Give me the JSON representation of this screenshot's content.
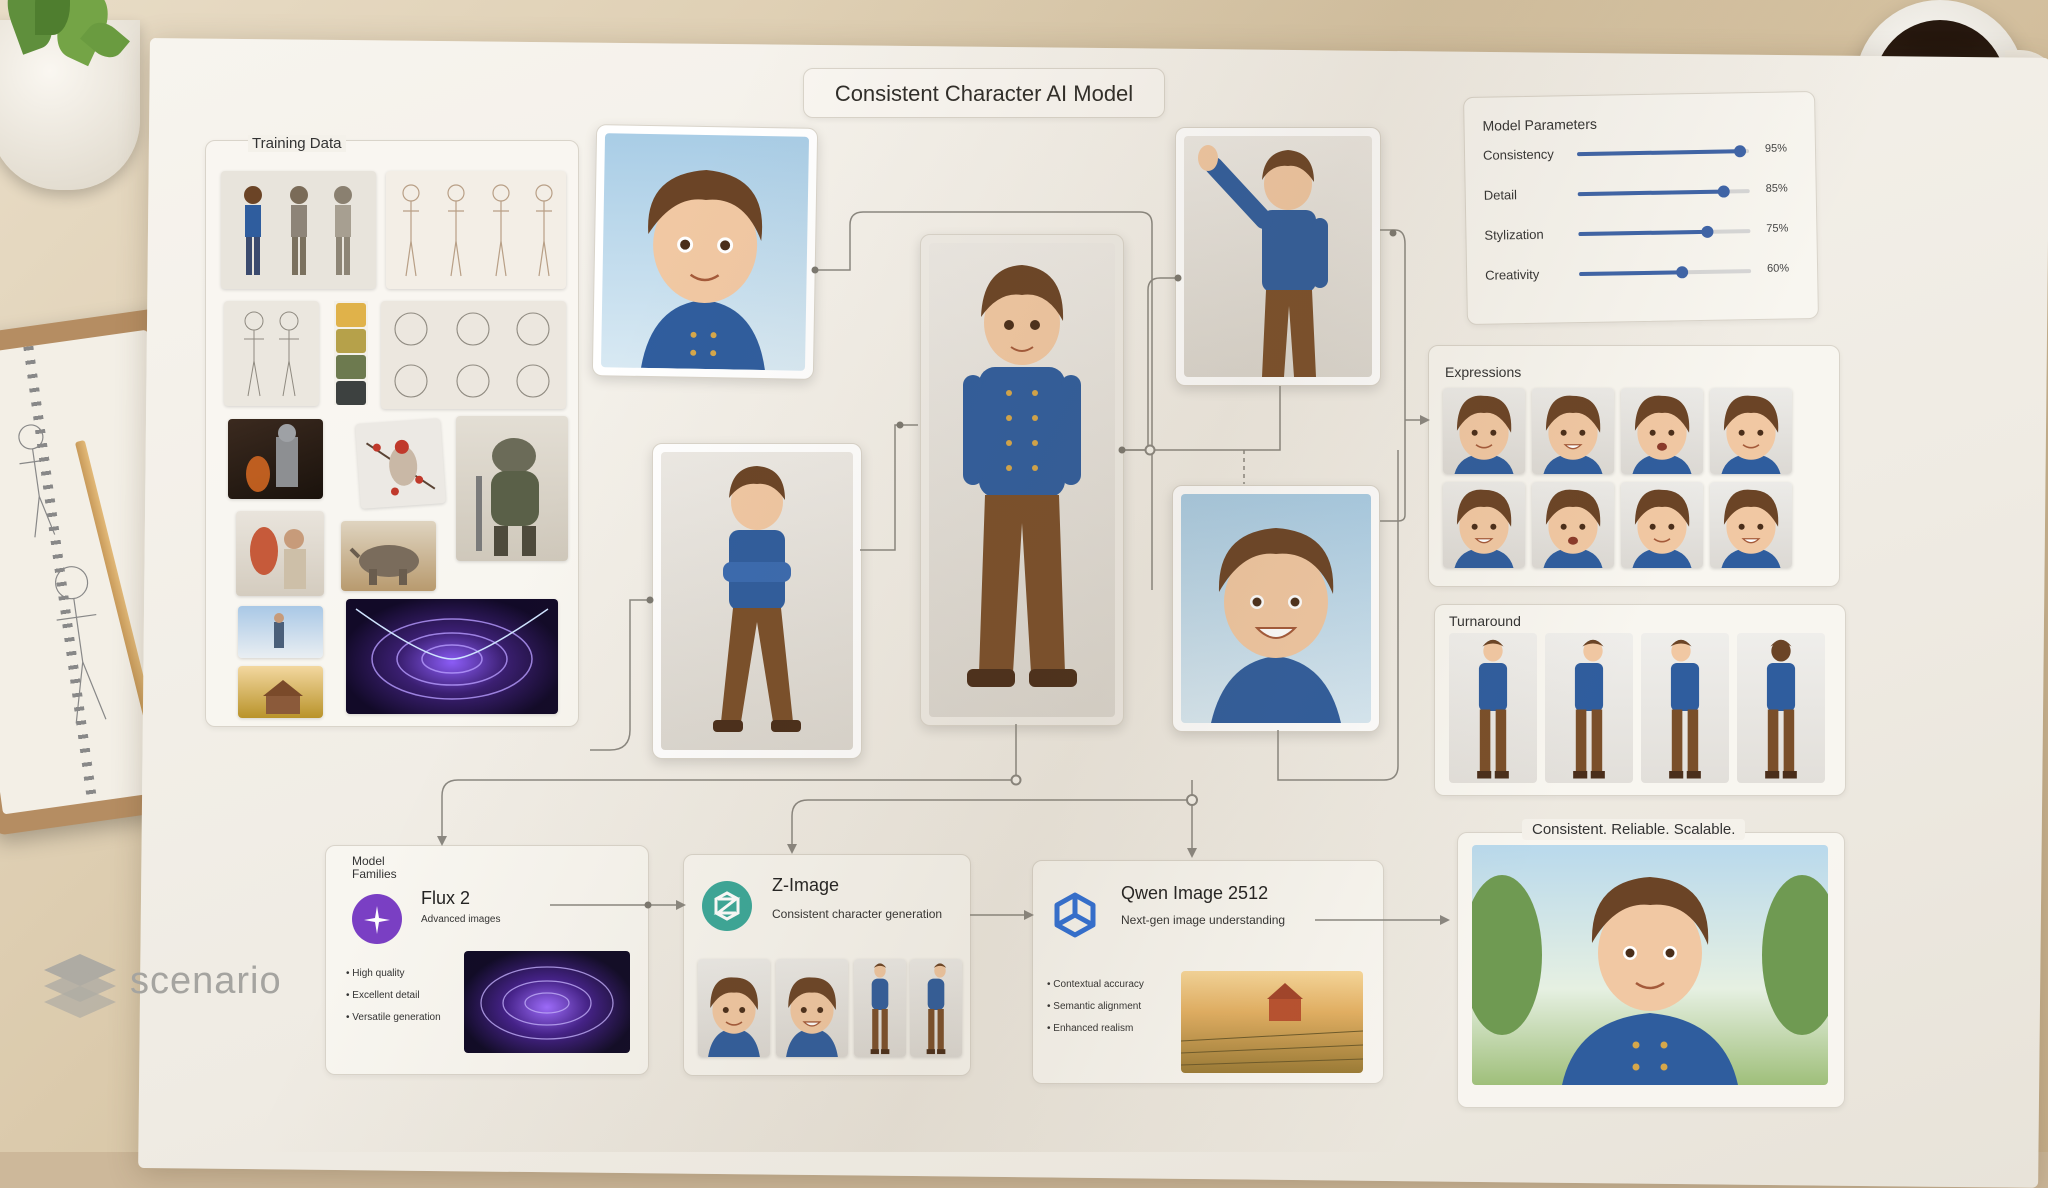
{
  "title": "Consistent Character AI Model",
  "training": {
    "title": "Training Data"
  },
  "params": {
    "title": "Model Parameters",
    "items": [
      {
        "label": "Consistency",
        "value_text": "95%",
        "value": 0.95
      },
      {
        "label": "Detail",
        "value_text": "85%",
        "value": 0.85
      },
      {
        "label": "Stylization",
        "value_text": "75%",
        "value": 0.75
      },
      {
        "label": "Creativity",
        "value_text": "60%",
        "value": 0.6
      }
    ]
  },
  "expressions": {
    "title": "Expressions"
  },
  "turnaround": {
    "title": "Turnaround"
  },
  "families": {
    "title_line1": "Model",
    "title_line2": "Families",
    "flux": {
      "name": "Flux 2",
      "subtitle": "Advanced images",
      "bullets": [
        "High quality",
        "Excellent detail",
        "Versatile generation"
      ]
    }
  },
  "zimage": {
    "name": "Z-Image",
    "subtitle": "Consistent character generation"
  },
  "qwen": {
    "name": "Qwen Image 2512",
    "subtitle": "Next-gen image understanding",
    "bullets": [
      "Contextual accuracy",
      "Semantic alignment",
      "Enhanced realism"
    ]
  },
  "result": {
    "banner": "Consistent. Reliable. Scalable."
  },
  "logo": {
    "wordmark": "scenario"
  },
  "colors": {
    "accent_blue": "#3e64a8",
    "jacket_blue": "#2f5d9e",
    "hair_brown": "#6b4426",
    "pants_brown": "#7a4f2a",
    "flux_purple": "#7a3fc4",
    "zimage_teal": "#3aa89a",
    "qwen_blue": "#2f6fd6",
    "palette": [
      "#e0b24a",
      "#b6a14a",
      "#6d7a4f",
      "#3d4140"
    ]
  }
}
